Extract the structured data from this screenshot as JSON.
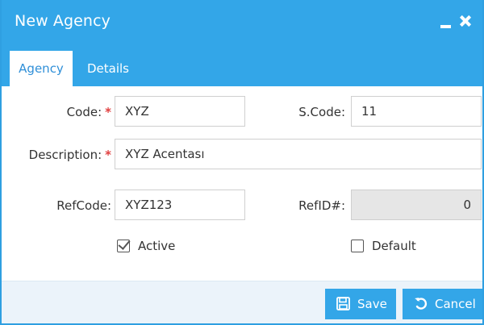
{
  "window": {
    "title": "New Agency"
  },
  "tabs": [
    {
      "label": "Agency",
      "active": true
    },
    {
      "label": "Details",
      "active": false
    }
  ],
  "form": {
    "code": {
      "label": "Code:",
      "required_mark": "*",
      "value": "XYZ"
    },
    "scode": {
      "label": "S.Code:",
      "value": "11"
    },
    "description": {
      "label": "Description:",
      "required_mark": "*",
      "value": "XYZ Acentası"
    },
    "refcode": {
      "label": "RefCode:",
      "value": "XYZ123"
    },
    "refid": {
      "label": "RefID#:",
      "value": "0"
    },
    "active": {
      "label": "Active",
      "checked": true
    },
    "default": {
      "label": "Default",
      "checked": false
    }
  },
  "footer": {
    "save_label": "Save",
    "cancel_label": "Cancel"
  },
  "colors": {
    "accent": "#33a6e8",
    "required": "#e04040",
    "readonly_bg": "#e6e6e6",
    "footer_bg": "#ebf3fa"
  },
  "icons": {
    "minimize": "minimize-icon",
    "close": "close-icon",
    "save": "floppy-disk-icon",
    "cancel": "undo-arrow-icon",
    "checkbox": "check-icon"
  }
}
